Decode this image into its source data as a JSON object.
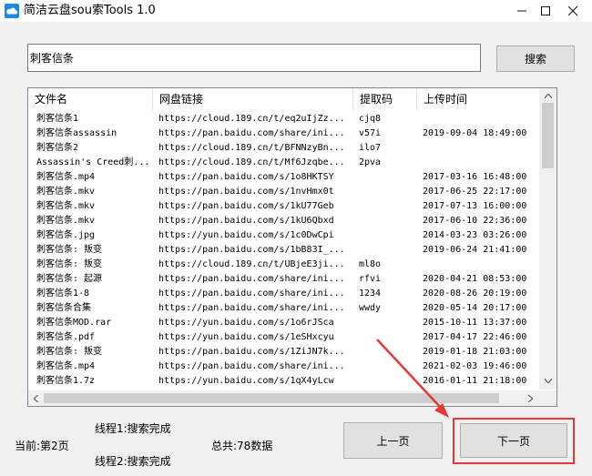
{
  "window": {
    "title": "简洁云盘sou索Tools 1.0",
    "icon": "cloud-icon",
    "controls": [
      "minimize-icon",
      "maximize-icon",
      "close-icon"
    ]
  },
  "search": {
    "value": "刺客信条",
    "button_label": "搜索"
  },
  "table": {
    "columns": [
      "文件名",
      "网盘链接",
      "提取码",
      "上传时间"
    ],
    "rows": [
      {
        "name": "刺客信条1",
        "link": "https://cloud.189.cn/t/eq2uIjZz...",
        "code": "cjq8",
        "time": ""
      },
      {
        "name": "刺客信条assassin",
        "link": "https://pan.baidu.com/share/ini...",
        "code": "v57i",
        "time": "2019-09-04 18:49:00"
      },
      {
        "name": "刺客信条2",
        "link": "https://cloud.189.cn/t/BFNNzyBn...",
        "code": "ilo7",
        "time": ""
      },
      {
        "name": "Assassin's Creed刺...",
        "link": "https://cloud.189.cn/t/Mf6Jzqbe...",
        "code": "2pva",
        "time": ""
      },
      {
        "name": "刺客信条.mp4",
        "link": "https://pan.baidu.com/s/1o8HKTSY",
        "code": "",
        "time": "2017-03-16 16:48:00"
      },
      {
        "name": "刺客信条.mkv",
        "link": "https://pan.baidu.com/s/1nvHmx0t",
        "code": "",
        "time": "2017-06-25 22:17:00"
      },
      {
        "name": "刺客信条.mkv",
        "link": "https://pan.baidu.com/s/1kU77Geb",
        "code": "",
        "time": "2017-07-13 16:00:00"
      },
      {
        "name": "刺客信条.mkv",
        "link": "https://pan.baidu.com/s/1kU6Qbxd",
        "code": "",
        "time": "2017-06-10 22:36:00"
      },
      {
        "name": "刺客信条.jpg",
        "link": "https://yun.baidu.com/s/1c0DwCpi",
        "code": "",
        "time": "2014-03-23 03:26:00"
      },
      {
        "name": "刺客信条: 叛变",
        "link": "https://pan.baidu.com/s/1bB83I_...",
        "code": "",
        "time": "2019-06-24 21:41:00"
      },
      {
        "name": "刺客信条: 叛变",
        "link": "https://cloud.189.cn/t/UBjeE3ji...",
        "code": "ml8o",
        "time": ""
      },
      {
        "name": "刺客信条: 起源",
        "link": "https://pan.baidu.com/share/ini...",
        "code": "rfvi",
        "time": "2020-04-21 08:53:00"
      },
      {
        "name": "刺客信条1-8",
        "link": "https://pan.baidu.com/share/ini...",
        "code": "1234",
        "time": "2020-08-26 20:19:00"
      },
      {
        "name": "刺客信条合集",
        "link": "https://pan.baidu.com/share/ini...",
        "code": "wwdy",
        "time": "2020-05-14 20:17:00"
      },
      {
        "name": "刺客信条MOD.rar",
        "link": "https://yun.baidu.com/s/1o6rJSca",
        "code": "",
        "time": "2015-10-11 13:37:00"
      },
      {
        "name": "刺客信条.pdf",
        "link": "https://yun.baidu.com/s/1eSHxcyu",
        "code": "",
        "time": "2017-04-17 22:46:00"
      },
      {
        "name": "刺客信条: 叛变",
        "link": "https://pan.baidu.com/s/1ZiJN7k...",
        "code": "",
        "time": "2019-01-18 21:03:00"
      },
      {
        "name": "刺客信条.mp4",
        "link": "https://pan.baidu.com/share/ini...",
        "code": "",
        "time": "2021-02-03 19:46:00"
      },
      {
        "name": "刺客信条1.7z",
        "link": "https://yun.baidu.com/s/1qX4yLcw",
        "code": "",
        "time": "2016-01-11 21:18:00"
      }
    ]
  },
  "status": {
    "current_page": "当前:第2页",
    "thread1": "线程1:搜索完成",
    "thread2": "线程2:搜索完成",
    "total": "总共:78数据"
  },
  "pager": {
    "prev_label": "上一页",
    "next_label": "下一页"
  },
  "colors": {
    "highlight": "#e53935",
    "window_bg": "#f0f0f0",
    "button_bg": "#e1e1e1",
    "icon_blue": "#1e88e5"
  }
}
